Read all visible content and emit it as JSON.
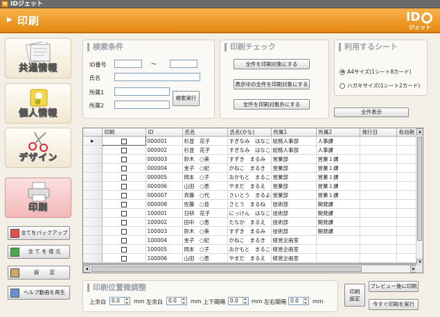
{
  "window": {
    "app_icon": "ID",
    "title": "IDジェット"
  },
  "header": {
    "title": "印刷",
    "logo_text": "ID",
    "logo_sub": "ジェット",
    "accent": "#ee9a22"
  },
  "sidebar": {
    "nav": [
      {
        "label": "共通情報",
        "icon": "document-icon"
      },
      {
        "label": "個人情報",
        "icon": "person-card-icon"
      },
      {
        "label": "デザイン",
        "icon": "scissors-icon"
      },
      {
        "label": "印刷",
        "icon": "printer-icon",
        "active": true
      }
    ],
    "actions": [
      {
        "label": "全てをバックアップ",
        "icon": "backup-icon"
      },
      {
        "label": "全 て を 復 元",
        "icon": "restore-icon"
      },
      {
        "label": "設　　定",
        "icon": "settings-icon"
      },
      {
        "label": "ヘルプ動画を再生",
        "icon": "help-video-icon"
      }
    ]
  },
  "search": {
    "title": "検索条件",
    "id_label": "ID番号",
    "tilde": "～",
    "name_label": "氏名",
    "dept1_label": "所属1",
    "dept2_label": "所属2",
    "run_button": "検索実行"
  },
  "print_check": {
    "title": "印刷チェック",
    "all_on": "全件を印刷対象にする",
    "shown_on": "表示中の全件を印刷対象にする",
    "all_off": "全件を印刷対象外にする"
  },
  "sheet": {
    "title": "利用するシート",
    "options": [
      {
        "label": "A4サイズ(1シート8カード)",
        "selected": true
      },
      {
        "label": "ハガキサイズ(1シート2カード)",
        "selected": false
      }
    ],
    "show_all_button": "全件表示"
  },
  "table": {
    "columns": [
      "印刷",
      "ID",
      "氏名",
      "氏名(かな)",
      "所属1",
      "所属2",
      "発行日",
      "有効期"
    ],
    "rows": [
      [
        "000001",
        "杉並　花子",
        "すぎなみ　はなこ",
        "総務人事部",
        "人事課"
      ],
      [
        "000002",
        "杉並　花子",
        "すぎなみ　はなこ",
        "総務人事部",
        "人事課"
      ],
      [
        "000003",
        "鈴木　○美",
        "すずき　まるみ",
        "営業部",
        "営業１課"
      ],
      [
        "000004",
        "金子　○紀",
        "かねこ　まるき",
        "営業部",
        "営業１課"
      ],
      [
        "000005",
        "岡本　○子",
        "おかもと　まるこ",
        "営業部",
        "営業１課"
      ],
      [
        "000006",
        "山田　○恵",
        "やまだ　まるえ",
        "営業部",
        "営業１課"
      ],
      [
        "000007",
        "斉藤　○代",
        "さいとう　まるよ",
        "営業部",
        "営業１課"
      ],
      [
        "000008",
        "佐藤　○音",
        "さとう　まるね",
        "技術部",
        "開発課"
      ],
      [
        "100001",
        "日研　花子",
        "にっけん　はなこ",
        "技術部",
        "開発課"
      ],
      [
        "100002",
        "田中　○恵",
        "たなか　まるえ",
        "技術部",
        "開発課"
      ],
      [
        "100003",
        "鈴木　○美",
        "すずき　まるみ",
        "技術部",
        "開発課"
      ],
      [
        "100004",
        "金子　○紀",
        "かねこ　まるき",
        "経営企画室",
        ""
      ],
      [
        "100005",
        "岡本　○子",
        "おかもと　まるこ",
        "経営企画室",
        ""
      ],
      [
        "100006",
        "山田　○恵",
        "やまだ　まるえ",
        "経営企画室",
        ""
      ]
    ]
  },
  "adjust": {
    "title": "印刷位置微調整",
    "fields": [
      {
        "label": "上余白",
        "value": "0.0",
        "unit": "mm"
      },
      {
        "label": "左余白",
        "value": "0.0",
        "unit": "mm"
      },
      {
        "label": "上下間隔",
        "value": "0.0",
        "unit": "mm"
      },
      {
        "label": "左右間隔",
        "value": "0.0",
        "unit": "mm"
      }
    ]
  },
  "print_buttons": {
    "settings": "印刷\n設定",
    "preview": "プレビュー後に印刷",
    "print_now": "今すぐ印刷を実行"
  }
}
